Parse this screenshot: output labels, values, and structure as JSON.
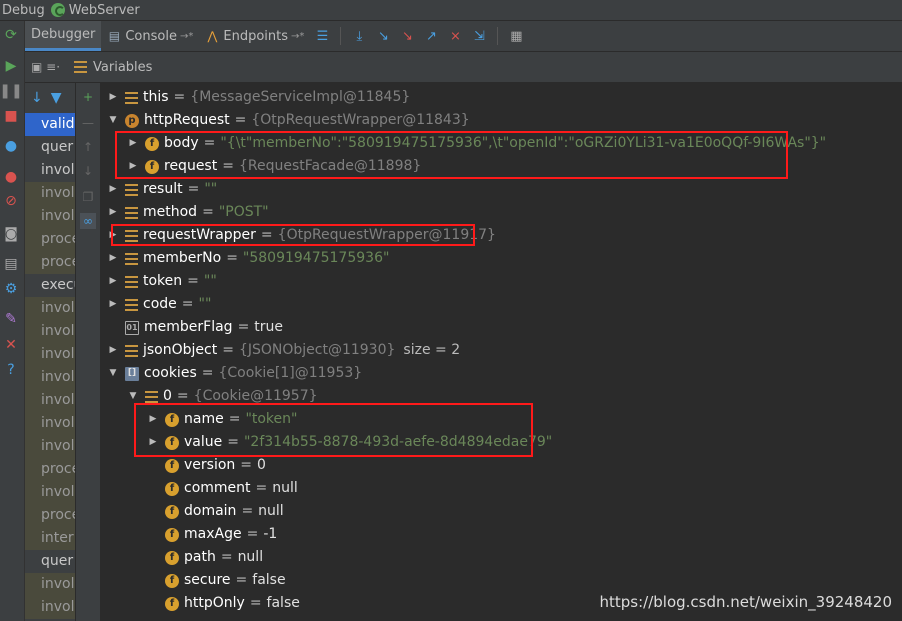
{
  "titlebar": {
    "title": "Debug",
    "config": "WebServer"
  },
  "toolbar": {
    "tabs": [
      {
        "label": "Debugger",
        "active": true
      },
      {
        "label": "Console",
        "active": false
      },
      {
        "label": "Endpoints",
        "active": false
      }
    ]
  },
  "panel": {
    "title": "Variables"
  },
  "frames": [
    {
      "label": "valid",
      "state": "selected"
    },
    {
      "label": "quer",
      "state": "normal"
    },
    {
      "label": "invol",
      "state": "normal"
    },
    {
      "label": "invol",
      "state": "library"
    },
    {
      "label": "invol",
      "state": "library"
    },
    {
      "label": "proce",
      "state": "library"
    },
    {
      "label": "proce",
      "state": "library"
    },
    {
      "label": "execu",
      "state": "normal"
    },
    {
      "label": "invol",
      "state": "library"
    },
    {
      "label": "invol",
      "state": "library"
    },
    {
      "label": "invol",
      "state": "library"
    },
    {
      "label": "invol",
      "state": "library"
    },
    {
      "label": "invol",
      "state": "library"
    },
    {
      "label": "invol",
      "state": "library"
    },
    {
      "label": "invol",
      "state": "library"
    },
    {
      "label": "proce",
      "state": "library"
    },
    {
      "label": "invol",
      "state": "library"
    },
    {
      "label": "proce",
      "state": "library"
    },
    {
      "label": "inter",
      "state": "library"
    },
    {
      "label": "quer",
      "state": "normal"
    },
    {
      "label": "invol",
      "state": "library"
    },
    {
      "label": "invol",
      "state": "library"
    }
  ],
  "variables": [
    {
      "name": "this",
      "value": "{MessageServiceImpl@11845}",
      "vtype": "obj",
      "icon": "bars",
      "arrow": "collapsed",
      "indent": 0
    },
    {
      "name": "httpRequest",
      "value": "{OtpRequestWrapper@11843}",
      "vtype": "obj",
      "icon": "p",
      "arrow": "expanded",
      "indent": 0
    },
    {
      "name": "body",
      "value": "\"{\\t\"memberNo\":\"580919475175936\",\\t\"openId\":\"oGRZi0YLi31-va1E0oQQf-9I6WAs\"}\"",
      "vtype": "str",
      "icon": "f",
      "arrow": "collapsed",
      "indent": 1
    },
    {
      "name": "request",
      "value": "{RequestFacade@11898}",
      "vtype": "obj",
      "icon": "f",
      "arrow": "collapsed",
      "indent": 1
    },
    {
      "name": "result",
      "value": "\"\"",
      "vtype": "str",
      "icon": "bars",
      "arrow": "collapsed",
      "indent": 0
    },
    {
      "name": "method",
      "value": "\"POST\"",
      "vtype": "str",
      "icon": "bars",
      "arrow": "collapsed",
      "indent": 0
    },
    {
      "name": "requestWrapper",
      "value": "{OtpRequestWrapper@11917}",
      "vtype": "obj",
      "icon": "bars",
      "arrow": "collapsed",
      "indent": 0
    },
    {
      "name": "memberNo",
      "value": "\"580919475175936\"",
      "vtype": "str",
      "icon": "bars",
      "arrow": "collapsed",
      "indent": 0
    },
    {
      "name": "token",
      "value": "\"\"",
      "vtype": "str",
      "icon": "bars",
      "arrow": "collapsed",
      "indent": 0
    },
    {
      "name": "code",
      "value": "\"\"",
      "vtype": "str",
      "icon": "bars",
      "arrow": "collapsed",
      "indent": 0
    },
    {
      "name": "memberFlag",
      "value": "true",
      "vtype": "kw",
      "icon": "prim",
      "arrow": "none",
      "indent": 0
    },
    {
      "name": "jsonObject",
      "value": "{JSONObject@11930}",
      "vtype": "obj",
      "icon": "bars",
      "arrow": "collapsed",
      "indent": 0,
      "extra": "size = 2"
    },
    {
      "name": "cookies",
      "value": "{Cookie[1]@11953}",
      "vtype": "obj",
      "icon": "arr",
      "arrow": "expanded",
      "indent": 0
    },
    {
      "name": "0",
      "value": "{Cookie@11957}",
      "vtype": "obj",
      "icon": "bars",
      "arrow": "expanded",
      "indent": 1
    },
    {
      "name": "name",
      "value": "\"token\"",
      "vtype": "str",
      "icon": "f",
      "arrow": "collapsed",
      "indent": 2
    },
    {
      "name": "value",
      "value": "\"2f314b55-8878-493d-aefe-8d4894edae79\"",
      "vtype": "str",
      "icon": "f",
      "arrow": "collapsed",
      "indent": 2
    },
    {
      "name": "version",
      "value": "0",
      "vtype": "num",
      "icon": "f",
      "arrow": "none",
      "indent": 2
    },
    {
      "name": "comment",
      "value": "null",
      "vtype": "kw",
      "icon": "f",
      "arrow": "none",
      "indent": 2
    },
    {
      "name": "domain",
      "value": "null",
      "vtype": "kw",
      "icon": "f",
      "arrow": "none",
      "indent": 2
    },
    {
      "name": "maxAge",
      "value": "-1",
      "vtype": "num",
      "icon": "f",
      "arrow": "none",
      "indent": 2
    },
    {
      "name": "path",
      "value": "null",
      "vtype": "kw",
      "icon": "f",
      "arrow": "none",
      "indent": 2
    },
    {
      "name": "secure",
      "value": "false",
      "vtype": "kw",
      "icon": "f",
      "arrow": "none",
      "indent": 2
    },
    {
      "name": "httpOnly",
      "value": "false",
      "vtype": "kw",
      "icon": "f",
      "arrow": "none",
      "indent": 2
    }
  ],
  "watermark": "https://blog.csdn.net/weixin_39248420",
  "colors": {
    "highlight": "#ff1a1a",
    "selection": "#2f65ca",
    "string": "#6a8759",
    "background": "#2b2b2b"
  }
}
